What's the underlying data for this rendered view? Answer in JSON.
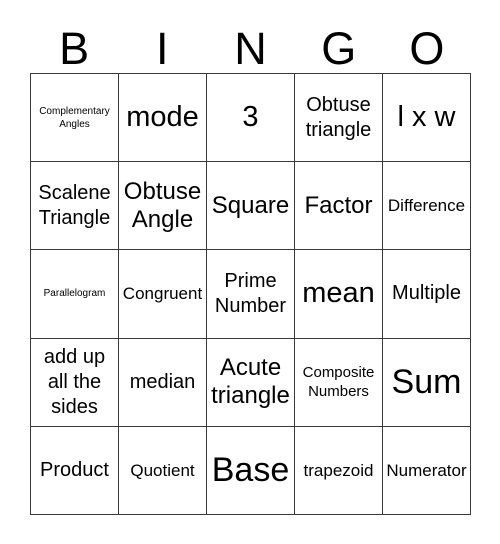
{
  "card": {
    "title": "BINGO",
    "header_letters": [
      "B",
      "I",
      "N",
      "G",
      "O"
    ],
    "columns": 5,
    "rows": 5,
    "border_color": "#3a3a3a",
    "background_color": "#ffffff",
    "text_color": "#000000"
  },
  "grid": {
    "cells": [
      {
        "text": "Complementary Angles",
        "size": "sz-xs"
      },
      {
        "text": "mode",
        "size": "sz-xl"
      },
      {
        "text": "3",
        "size": "sz-xl"
      },
      {
        "text": "Obtuse\ntriangle",
        "size": "sz-ml"
      },
      {
        "text": "l x w",
        "size": "sz-xl"
      },
      {
        "text": "Scalene\nTriangle",
        "size": "sz-ml"
      },
      {
        "text": "Obtuse\nAngle",
        "size": "sz-l"
      },
      {
        "text": "Square",
        "size": "sz-l"
      },
      {
        "text": "Factor",
        "size": "sz-l"
      },
      {
        "text": "Difference",
        "size": "sz-m"
      },
      {
        "text": "Parallelogram",
        "size": "sz-xs"
      },
      {
        "text": "Congruent",
        "size": "sz-m"
      },
      {
        "text": "Prime\nNumber",
        "size": "sz-ml"
      },
      {
        "text": "mean",
        "size": "sz-xl"
      },
      {
        "text": "Multiple",
        "size": "sz-ml"
      },
      {
        "text": "add up\nall the\nsides",
        "size": "sz-ml"
      },
      {
        "text": "median",
        "size": "sz-ml"
      },
      {
        "text": "Acute\ntriangle",
        "size": "sz-l"
      },
      {
        "text": "Composite\nNumbers",
        "size": "sz-s"
      },
      {
        "text": "Sum",
        "size": "sz-xxl"
      },
      {
        "text": "Product",
        "size": "sz-ml"
      },
      {
        "text": "Quotient",
        "size": "sz-m"
      },
      {
        "text": "Base",
        "size": "sz-xxl"
      },
      {
        "text": "trapezoid",
        "size": "sz-m"
      },
      {
        "text": "Numerator",
        "size": "sz-m"
      }
    ]
  }
}
